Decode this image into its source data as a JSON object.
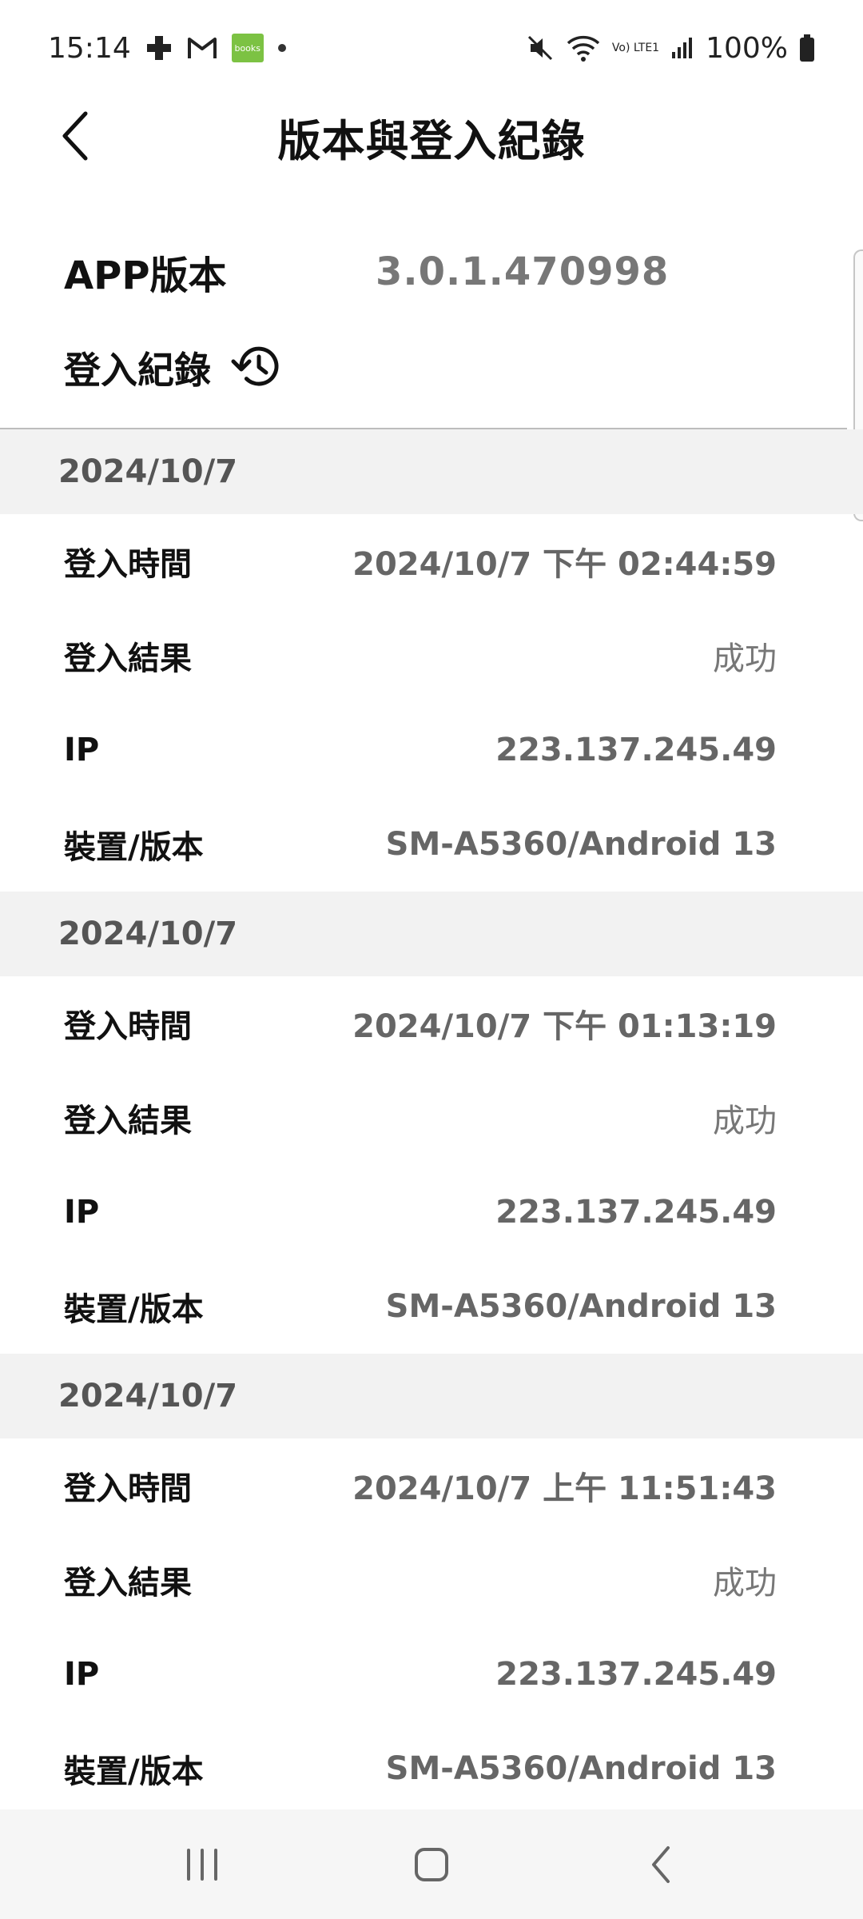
{
  "status_bar": {
    "time": "15:14",
    "battery": "100%",
    "books_badge": "books",
    "notification_icons": [
      "medical-cross-icon",
      "gmail-icon",
      "books-app-icon",
      "dot-icon"
    ],
    "system_icons": [
      "mute-icon",
      "wifi-icon",
      "volte-icon",
      "signal-icon",
      "battery-icon"
    ],
    "volte_text": "Vo) LTE1"
  },
  "header": {
    "title": "版本與登入紀錄",
    "back_icon": "chevron-left-icon"
  },
  "app_version": {
    "label": "APP版本",
    "value": "3.0.1.470998"
  },
  "login_record": {
    "label": "登入紀錄",
    "icon": "history-icon"
  },
  "labels": {
    "login_time": "登入時間",
    "login_result": "登入結果",
    "ip": "IP",
    "device_version": "裝置/版本"
  },
  "records": [
    {
      "date": "2024/10/7",
      "login_time": "2024/10/7 下午 02:44:59",
      "login_result": "成功",
      "ip": "223.137.245.49",
      "device_version": "SM-A5360/Android 13"
    },
    {
      "date": "2024/10/7",
      "login_time": "2024/10/7 下午 01:13:19",
      "login_result": "成功",
      "ip": "223.137.245.49",
      "device_version": "SM-A5360/Android 13"
    },
    {
      "date": "2024/10/7",
      "login_time": "2024/10/7 上午 11:51:43",
      "login_result": "成功",
      "ip": "223.137.245.49",
      "device_version": "SM-A5360/Android 13"
    }
  ],
  "nav_bar": {
    "recents_icon": "recents-icon",
    "home_icon": "home-icon",
    "back_icon": "back-icon"
  },
  "colors": {
    "date_header_bg": "#f2f2f2",
    "value_text": "#666666",
    "nav_bg": "#f6f6f6"
  }
}
